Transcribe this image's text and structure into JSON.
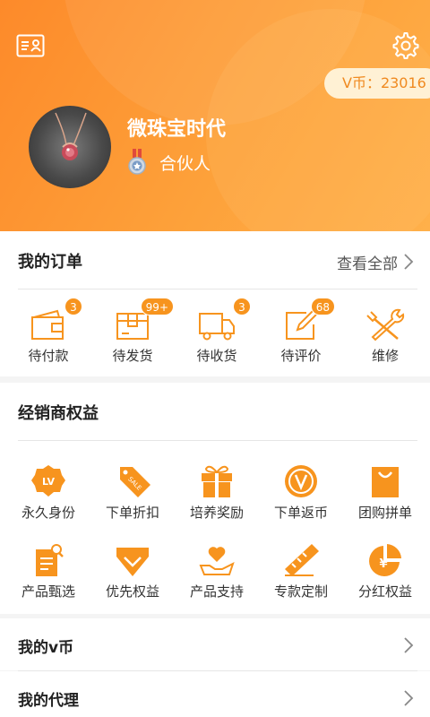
{
  "header": {
    "vcoin_text": "V币：23016",
    "user_name": "微珠宝时代",
    "role": "合伙人"
  },
  "orders": {
    "title": "我的订单",
    "view_all": "查看全部",
    "items": [
      {
        "label": "待付款",
        "badge": "3",
        "icon": "wallet-icon"
      },
      {
        "label": "待发货",
        "badge": "99+",
        "icon": "package-icon"
      },
      {
        "label": "待收货",
        "badge": "3",
        "icon": "delivery-truck-icon"
      },
      {
        "label": "待评价",
        "badge": "68",
        "icon": "edit-review-icon"
      },
      {
        "label": "维修",
        "badge": "",
        "icon": "repair-tools-icon"
      }
    ]
  },
  "rights": {
    "title": "经销商权益",
    "items": [
      {
        "label": "永久身份",
        "icon": "lv-badge-icon"
      },
      {
        "label": "下单折扣",
        "icon": "sale-tag-icon"
      },
      {
        "label": "培养奖励",
        "icon": "gift-icon"
      },
      {
        "label": "下单返币",
        "icon": "v-coin-icon"
      },
      {
        "label": "团购拼单",
        "icon": "shopping-bag-icon"
      },
      {
        "label": "产品甄选",
        "icon": "document-search-icon"
      },
      {
        "label": "优先权益",
        "icon": "shield-check-icon"
      },
      {
        "label": "产品支持",
        "icon": "heart-hand-icon"
      },
      {
        "label": "专款定制",
        "icon": "ruler-pencil-icon"
      },
      {
        "label": "分红权益",
        "icon": "pie-chart-yen-icon"
      }
    ]
  },
  "menu": {
    "my_vcoin": "我的v币",
    "my_agent": "我的代理"
  },
  "colors": {
    "accent": "#f7941e",
    "header_start": "#fd8a2a",
    "header_end": "#ffb04a"
  }
}
